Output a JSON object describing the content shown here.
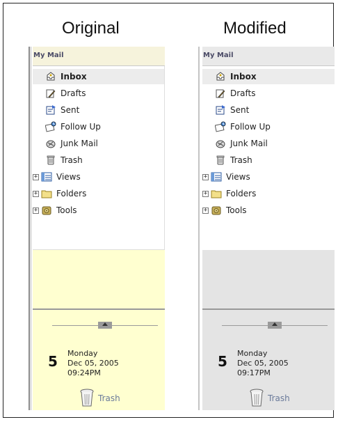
{
  "columns": [
    {
      "title": "Original",
      "header": "My Mail",
      "items": [
        {
          "label": "Inbox",
          "icon": "inbox-icon",
          "selected": true,
          "expandable": false
        },
        {
          "label": "Drafts",
          "icon": "drafts-icon",
          "selected": false,
          "expandable": false
        },
        {
          "label": "Sent",
          "icon": "sent-icon",
          "selected": false,
          "expandable": false
        },
        {
          "label": "Follow Up",
          "icon": "follow-up-icon",
          "selected": false,
          "expandable": false
        },
        {
          "label": "Junk Mail",
          "icon": "junk-mail-icon",
          "selected": false,
          "expandable": false
        },
        {
          "label": "Trash",
          "icon": "trash-icon",
          "selected": false,
          "expandable": false
        },
        {
          "label": "Views",
          "icon": "views-icon",
          "selected": false,
          "expandable": true
        },
        {
          "label": "Folders",
          "icon": "folder-icon",
          "selected": false,
          "expandable": true
        },
        {
          "label": "Tools",
          "icon": "tools-icon",
          "selected": false,
          "expandable": true
        }
      ],
      "date": {
        "day": "5",
        "weekday": "Monday",
        "date": "Dec 05, 2005",
        "time": "09:24PM"
      },
      "trash_label": "Trash",
      "background": "#ffffd0"
    },
    {
      "title": "Modified",
      "header": "My Mail",
      "items": [
        {
          "label": "Inbox",
          "icon": "inbox-icon",
          "selected": true,
          "expandable": false
        },
        {
          "label": "Drafts",
          "icon": "drafts-icon",
          "selected": false,
          "expandable": false
        },
        {
          "label": "Sent",
          "icon": "sent-icon",
          "selected": false,
          "expandable": false
        },
        {
          "label": "Follow Up",
          "icon": "follow-up-icon",
          "selected": false,
          "expandable": false
        },
        {
          "label": "Junk Mail",
          "icon": "junk-mail-icon",
          "selected": false,
          "expandable": false
        },
        {
          "label": "Trash",
          "icon": "trash-icon",
          "selected": false,
          "expandable": false
        },
        {
          "label": "Views",
          "icon": "views-icon",
          "selected": false,
          "expandable": true
        },
        {
          "label": "Folders",
          "icon": "folder-icon",
          "selected": false,
          "expandable": true
        },
        {
          "label": "Tools",
          "icon": "tools-icon",
          "selected": false,
          "expandable": true
        }
      ],
      "date": {
        "day": "5",
        "weekday": "Monday",
        "date": "Dec 05, 2005",
        "time": "09:17PM"
      },
      "trash_label": "Trash",
      "background": "#e4e4e4"
    }
  ]
}
